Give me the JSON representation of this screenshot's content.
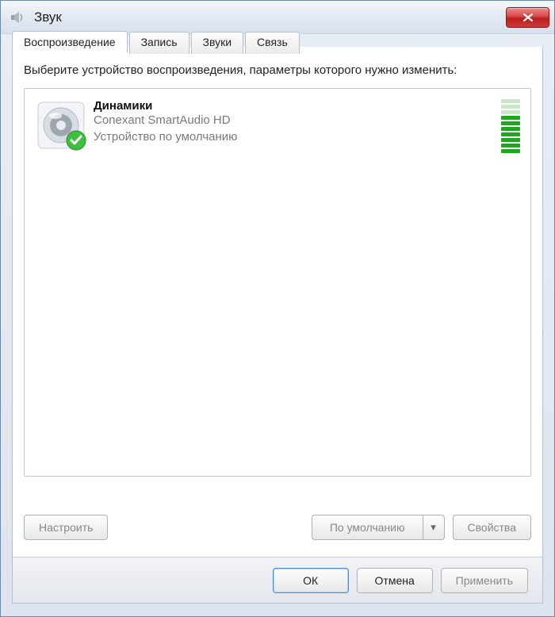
{
  "window": {
    "title": "Звук"
  },
  "tabs": [
    {
      "label": "Воспроизведение",
      "active": true
    },
    {
      "label": "Запись",
      "active": false
    },
    {
      "label": "Звуки",
      "active": false
    },
    {
      "label": "Связь",
      "active": false
    }
  ],
  "instruction": "Выберите устройство воспроизведения, параметры которого нужно изменить:",
  "devices": [
    {
      "name": "Динамики",
      "driver": "Conexant SmartAudio HD",
      "status": "Устройство по умолчанию",
      "level_active_bars": 7,
      "level_total_bars": 10
    }
  ],
  "buttons": {
    "configure": "Настроить",
    "set_default": "По умолчанию",
    "properties": "Свойства",
    "ok": "ОК",
    "cancel": "Отмена",
    "apply": "Применить"
  }
}
